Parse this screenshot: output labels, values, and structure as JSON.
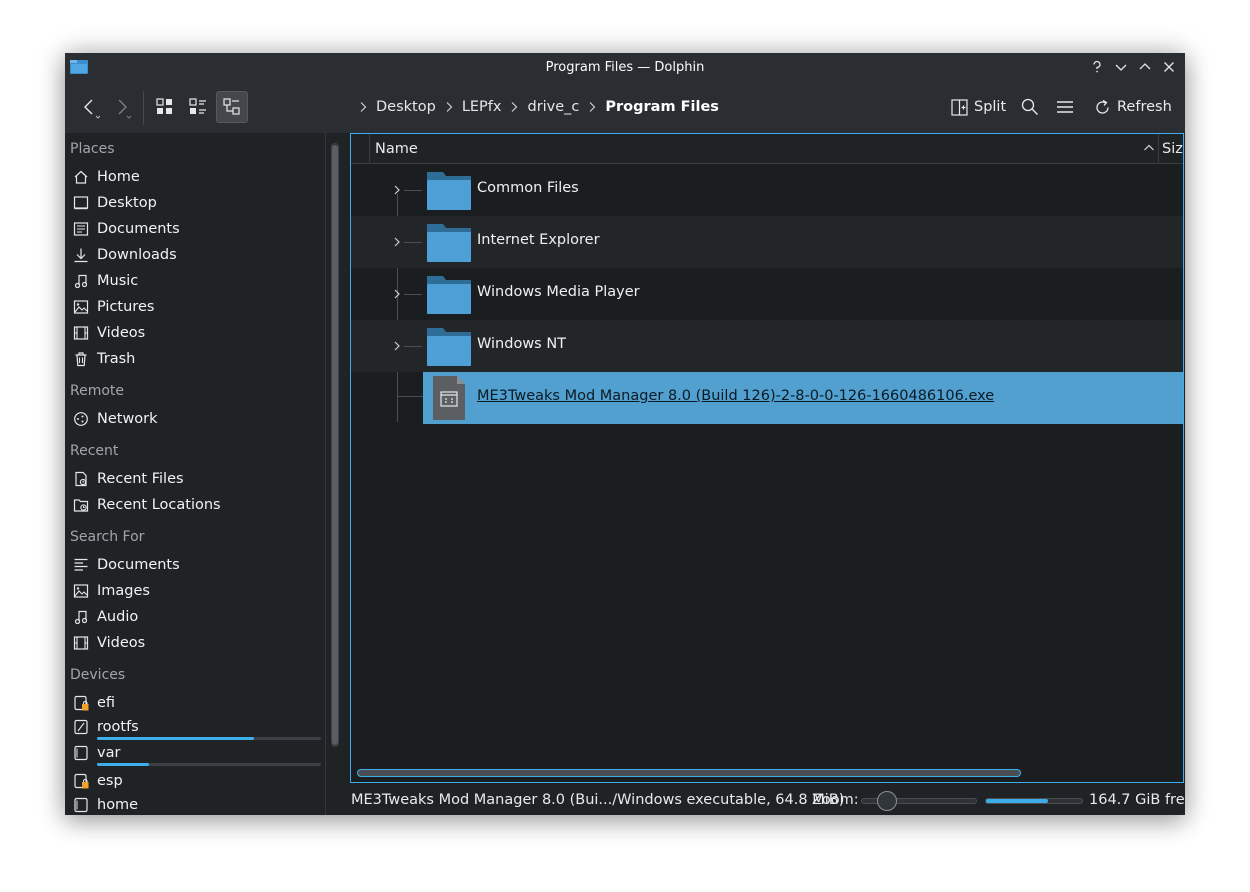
{
  "window": {
    "title": "Program Files — Dolphin"
  },
  "toolbar": {
    "breadcrumb": [
      "Desktop",
      "LEPfx",
      "drive_c",
      "Program Files"
    ],
    "split_label": "Split",
    "refresh_label": "Refresh"
  },
  "sidebar": {
    "places_label": "Places",
    "places": [
      {
        "label": "Home",
        "icon": "home-icon"
      },
      {
        "label": "Desktop",
        "icon": "desktop-icon"
      },
      {
        "label": "Documents",
        "icon": "documents-icon"
      },
      {
        "label": "Downloads",
        "icon": "downloads-icon"
      },
      {
        "label": "Music",
        "icon": "music-icon"
      },
      {
        "label": "Pictures",
        "icon": "pictures-icon"
      },
      {
        "label": "Videos",
        "icon": "videos-icon"
      },
      {
        "label": "Trash",
        "icon": "trash-icon"
      }
    ],
    "remote_label": "Remote",
    "remote": [
      {
        "label": "Network",
        "icon": "network-icon"
      }
    ],
    "recent_label": "Recent",
    "recent": [
      {
        "label": "Recent Files",
        "icon": "recent-files-icon"
      },
      {
        "label": "Recent Locations",
        "icon": "recent-locations-icon"
      }
    ],
    "search_label": "Search For",
    "search": [
      {
        "label": "Documents",
        "icon": "search-documents-icon"
      },
      {
        "label": "Images",
        "icon": "search-images-icon"
      },
      {
        "label": "Audio",
        "icon": "search-audio-icon"
      },
      {
        "label": "Videos",
        "icon": "search-videos-icon"
      }
    ],
    "devices_label": "Devices",
    "devices": [
      {
        "label": "efi",
        "icon": "drive-locked-icon"
      },
      {
        "label": "rootfs",
        "icon": "drive-icon",
        "usage": 0.7
      },
      {
        "label": "var",
        "icon": "drive-icon",
        "usage": 0.23
      },
      {
        "label": "esp",
        "icon": "drive-locked-icon"
      },
      {
        "label": "home",
        "icon": "drive-icon"
      }
    ]
  },
  "file_view": {
    "column_name": "Name",
    "column_size": "Size",
    "folders": [
      "Common Files",
      "Internet Explorer",
      "Windows Media Player",
      "Windows NT"
    ],
    "selected_file": "ME3Tweaks Mod Manager 8.0 (Build 126)-2-8-0-0-126-1660486106.exe"
  },
  "statusbar": {
    "text": "ME3Tweaks Mod Manager 8.0 (Bui.../Windows executable, 64.8 MiB)",
    "zoom_label": "Zoom:",
    "zoom_level": 0.22,
    "free_space": "164.7 GiB free",
    "disk_used": 0.65
  },
  "colors": {
    "accent": "#3daee9",
    "folder": "#4d9fd6",
    "selection": "#52a0d0"
  }
}
